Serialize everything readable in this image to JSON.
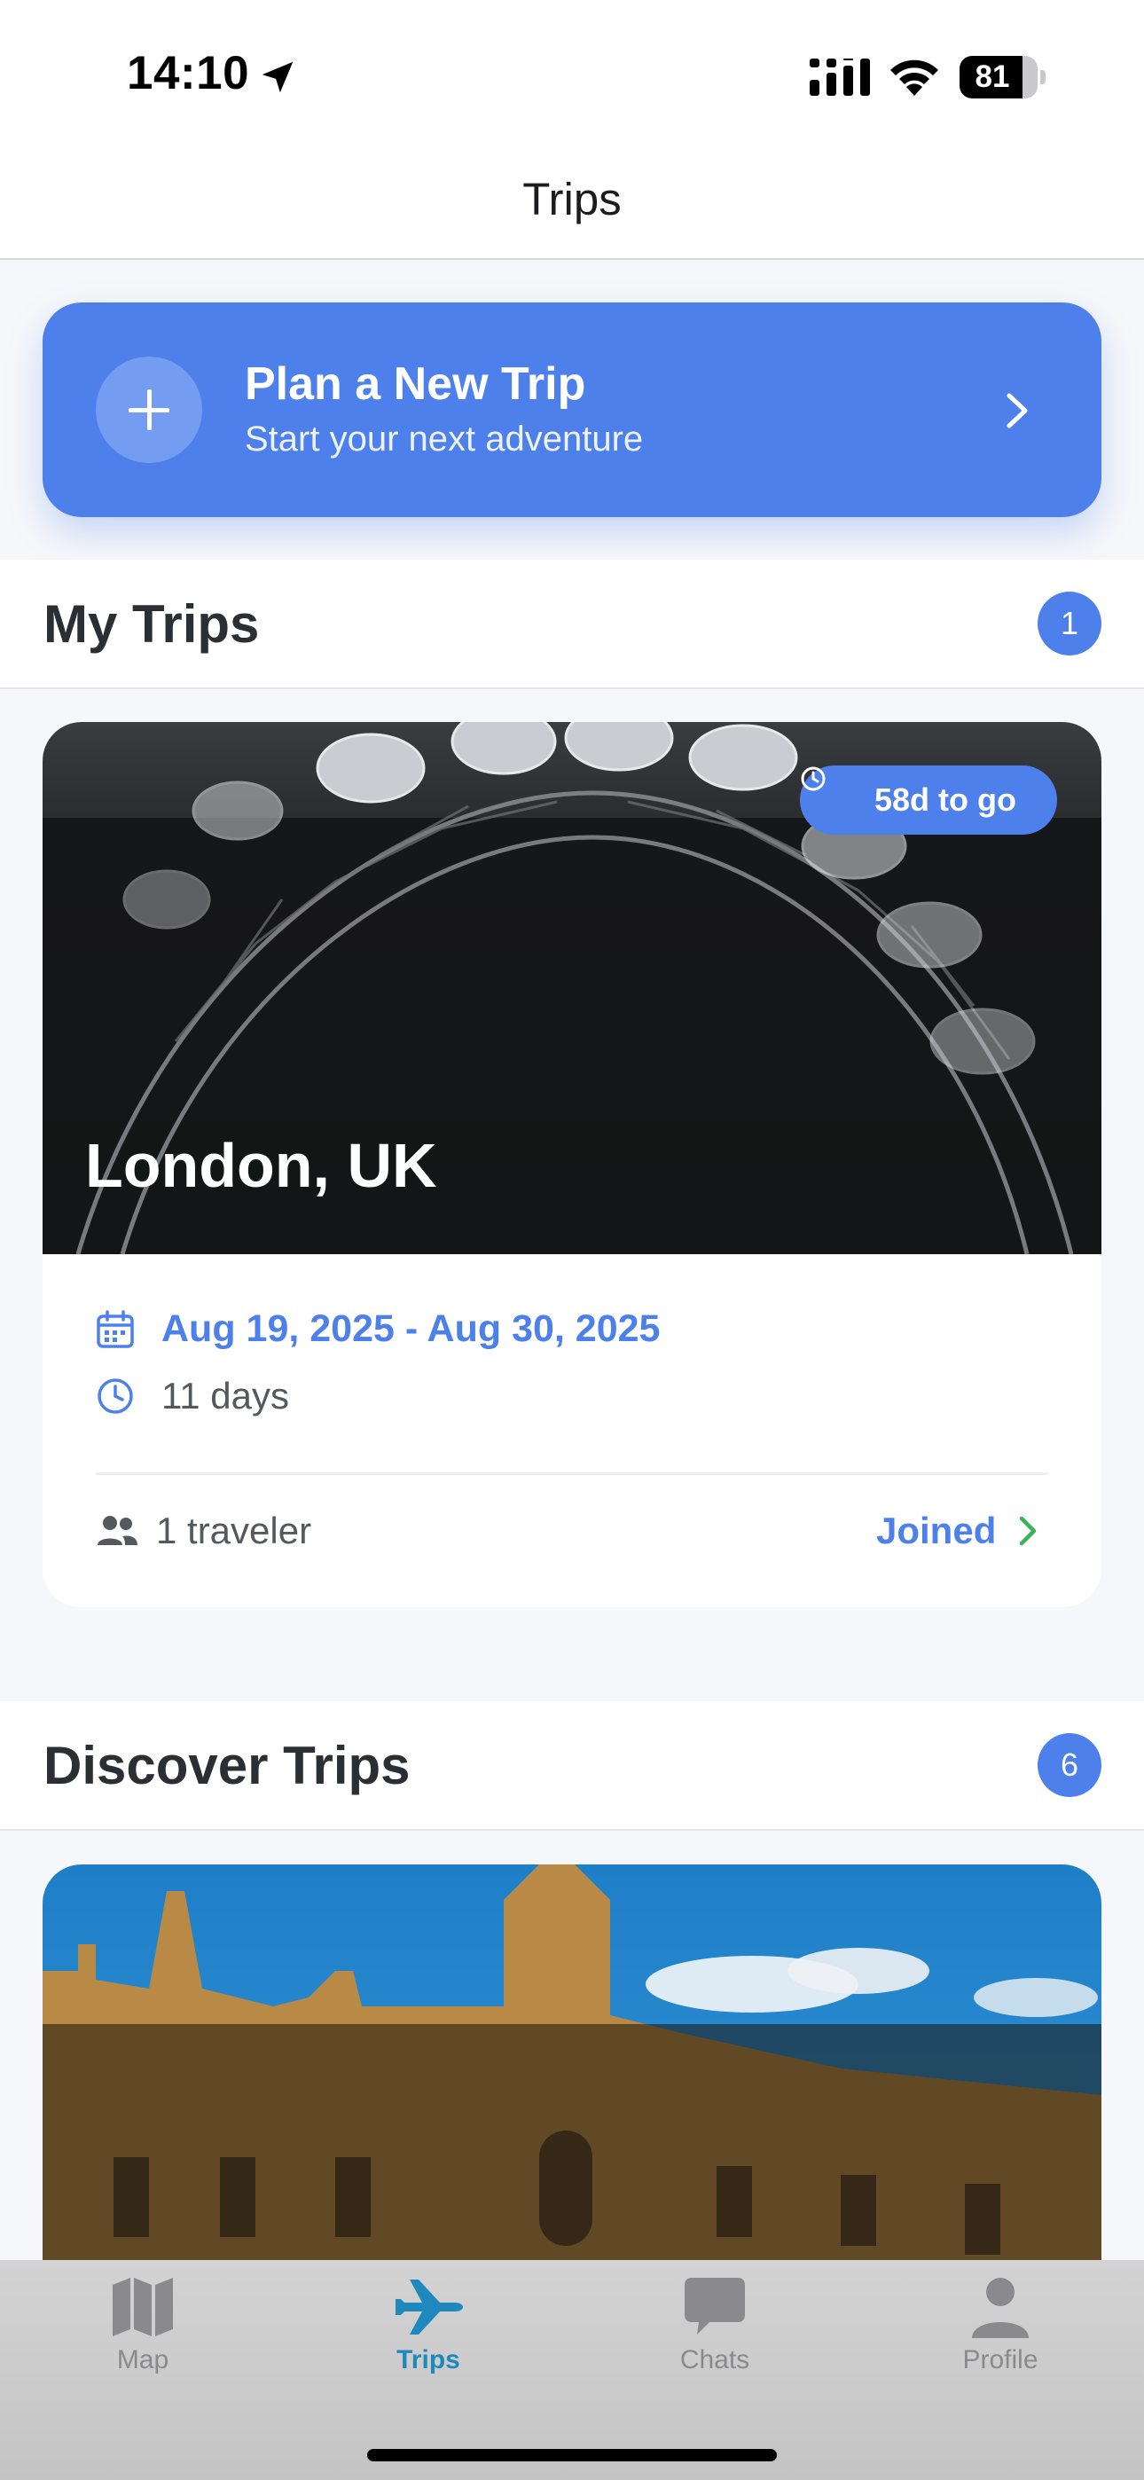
{
  "status_bar": {
    "time": "14:10",
    "battery": "81",
    "battery_level": 81
  },
  "nav": {
    "title": "Trips"
  },
  "plan_card": {
    "title": "Plan a New Trip",
    "subtitle": "Start your next adventure"
  },
  "my_trips": {
    "title": "My Trips",
    "count": "1",
    "trip": {
      "destination": "London, UK",
      "countdown": "58d to go",
      "dates": "Aug 19, 2025 - Aug 30, 2025",
      "duration": "11 days",
      "travelers": "1 traveler",
      "status": "Joined"
    }
  },
  "discover": {
    "title": "Discover Trips",
    "count": "6"
  },
  "tabs": [
    {
      "label": "Map",
      "icon": "map-icon",
      "active": false
    },
    {
      "label": "Trips",
      "icon": "airplane-icon",
      "active": true
    },
    {
      "label": "Chats",
      "icon": "chat-bubble-icon",
      "active": false
    },
    {
      "label": "Profile",
      "icon": "person-icon",
      "active": false
    }
  ],
  "colors": {
    "accent": "#4e80ec",
    "active_tab": "#1f89be",
    "joined_chevron": "#3db25c"
  }
}
